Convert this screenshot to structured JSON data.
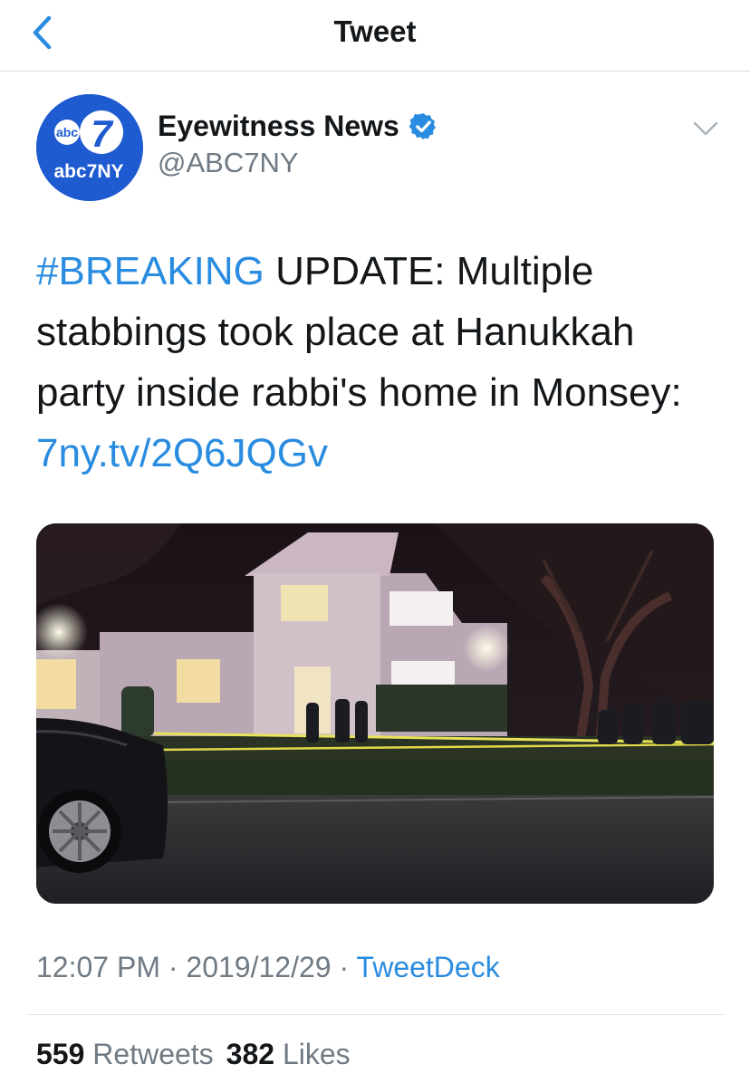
{
  "header": {
    "title": "Tweet",
    "back_icon": "chevron-left-icon"
  },
  "author": {
    "name": "Eyewitness News",
    "handle": "@ABC7NY",
    "verified": true,
    "avatar": {
      "logo_text_small": "abc",
      "logo_numeral": "7",
      "logo_text": "abc7NY"
    }
  },
  "tweet": {
    "hashtag": "#BREAKING",
    "line1_rest": " UPDATE: Multiple",
    "line2": "stabbings took place at Hanukkah",
    "line3": "party inside rabbi's home in Monsey:",
    "link": "7ny.tv/2Q6JQGv"
  },
  "meta": {
    "time": "12:07 PM",
    "sep1": " · ",
    "date": "2019/12/29",
    "sep2": " · ",
    "source": "TweetDeck"
  },
  "stats": {
    "retweets_count": "559",
    "retweets_label": "Retweets",
    "likes_count": "382",
    "likes_label": "Likes"
  },
  "colors": {
    "accent": "#2a8ce0",
    "text": "#14171a",
    "secondary": "#6f7a84",
    "avatar_bg": "#1f5bd0"
  }
}
